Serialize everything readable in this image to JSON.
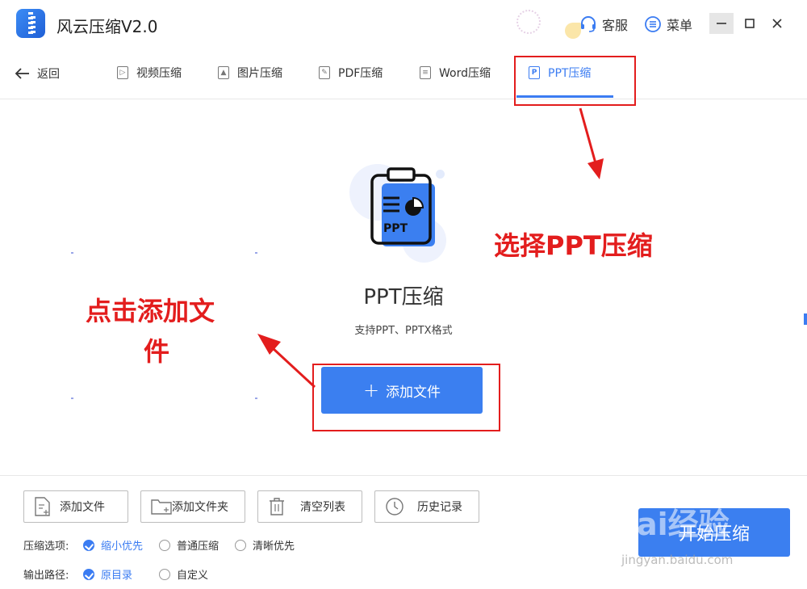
{
  "app": {
    "title": "风云压缩V2.0"
  },
  "header": {
    "service_label": "客服",
    "menu_label": "菜单"
  },
  "nav": {
    "back_label": "返回",
    "tabs": [
      {
        "label": "视频压缩",
        "icon": "video-icon"
      },
      {
        "label": "图片压缩",
        "icon": "image-icon"
      },
      {
        "label": "PDF压缩",
        "icon": "pdf-icon"
      },
      {
        "label": "Word压缩",
        "icon": "word-icon"
      },
      {
        "label": "PPT压缩",
        "icon": "ppt-icon",
        "active": true
      }
    ]
  },
  "main": {
    "illustration_label": "PPT",
    "title": "PPT压缩",
    "subtitle": "支持PPT、PPTX格式",
    "add_button": "添加文件"
  },
  "annotations": {
    "select_tab": "选择PPT压缩",
    "click_add_line1": "点击添加文",
    "click_add_line2": "件"
  },
  "footer": {
    "buttons": [
      {
        "label": "添加文件",
        "icon": "add-file-icon"
      },
      {
        "label": "添加文件夹",
        "icon": "add-folder-icon"
      },
      {
        "label": "清空列表",
        "icon": "trash-icon"
      },
      {
        "label": "历史记录",
        "icon": "clock-icon"
      }
    ],
    "compress_label": "压缩选项:",
    "compress_options": [
      {
        "label": "缩小优先",
        "selected": true
      },
      {
        "label": "普通压缩",
        "selected": false
      },
      {
        "label": "清晰优先",
        "selected": false
      }
    ],
    "output_label": "输出路径:",
    "output_options": [
      {
        "label": "原目录",
        "selected": true
      },
      {
        "label": "自定义",
        "selected": false
      }
    ],
    "start_button": "开始压缩"
  },
  "watermark": {
    "text": "Bai经验",
    "sub": "jingyan.baidu.com"
  },
  "colors": {
    "accent": "#3b7cf2",
    "annotation": "#e31d1d"
  }
}
